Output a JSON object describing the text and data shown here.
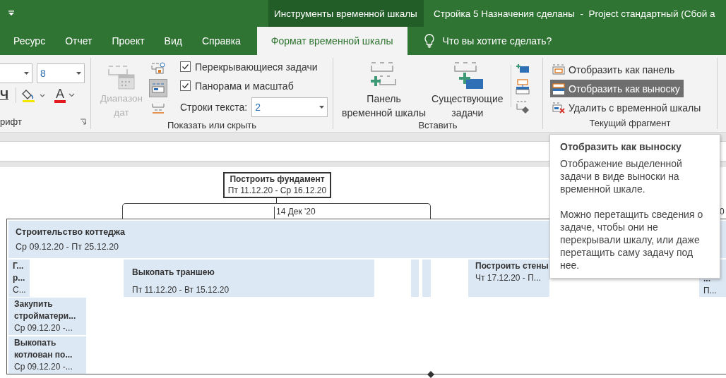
{
  "title_bar": {
    "context_tab_group": "Инструменты временной шкалы",
    "document_title": "Стройка 5 Назначения сделаны  -  Project стандартный (Сбой а"
  },
  "tabs": [
    {
      "label": "Ресурс",
      "selected": false
    },
    {
      "label": "Отчет",
      "selected": false
    },
    {
      "label": "Проект",
      "selected": false
    },
    {
      "label": "Вид",
      "selected": false
    },
    {
      "label": "Справка",
      "selected": false
    },
    {
      "label": "Формат временной шкалы",
      "selected": true
    }
  ],
  "tell_me": {
    "placeholder": "Что вы хотите сделать?"
  },
  "font_group": {
    "label": "рифт",
    "font_size": "8",
    "underline": "Ч",
    "font_color_letter": "A"
  },
  "show_hide_group": {
    "label": "Показать или скрыть",
    "date_range_button": {
      "label": "Диапазон дат",
      "disabled": true
    },
    "layout_buttons": [
      {
        "selected": false
      },
      {
        "selected": true
      },
      {
        "selected": false
      }
    ],
    "checkboxes": [
      {
        "label": "Перекрывающиеся задачи",
        "checked": true
      },
      {
        "label": "Панорама и масштаб",
        "checked": true
      }
    ],
    "text_lines": {
      "label": "Строки текста:",
      "value": "2"
    }
  },
  "insert_group": {
    "label": "Вставить",
    "buttons": [
      {
        "lines": [
          "Панель",
          "временной шкалы"
        ]
      },
      {
        "lines": [
          "Существующие",
          "задачи"
        ]
      }
    ]
  },
  "current_item_group": {
    "label": "Текущий фрагмент",
    "buttons": [
      {
        "label": "Отобразить как панель",
        "selected": false
      },
      {
        "label": "Отобразить как выноску",
        "selected": true
      },
      {
        "label": "Удалить с временной шкалы",
        "selected": false
      }
    ]
  },
  "timeline": {
    "callout": {
      "title": "Построить фундамент",
      "dates": "Пт 11.12.20 - Ср 16.12.20"
    },
    "scale_labels": [
      "14 Дек '20",
      "0"
    ],
    "summary": {
      "title": "Строительство коттеджа",
      "dates": "Ср 09.12.20 - Пт 25.12.20"
    },
    "tasks": [
      {
        "kind": "labeled",
        "title": "Г... р...",
        "dates": "С..."
      },
      {
        "kind": "labeled",
        "title": "Выкопать траншею",
        "dates": "Пт 11.12.20 - Вт 15.12.20"
      },
      {
        "kind": "blank"
      },
      {
        "kind": "blank"
      },
      {
        "kind": "labeled",
        "title": "Построить стены",
        "dates": "Чт 17.12.20 - П..."
      },
      {
        "kind": "labeled",
        "title": "...",
        "dates": "П..."
      },
      {
        "kind": "labeled",
        "title": "Закупить стройматери...",
        "dates": "Ср 09.12.20 -..."
      },
      {
        "kind": "labeled",
        "title": "Выкопать котлован по...",
        "dates": "Ср 09.12.20 -..."
      }
    ]
  },
  "tooltip": {
    "title": "Отобразить как выноску",
    "paragraphs": [
      "Отображение выделенной задачи в виде выноски на временной шкале.",
      "Можно перетащить сведения о задаче, чтобы они не перекрывали шкалу, или даже перетащить саму задачу под нее."
    ]
  }
}
